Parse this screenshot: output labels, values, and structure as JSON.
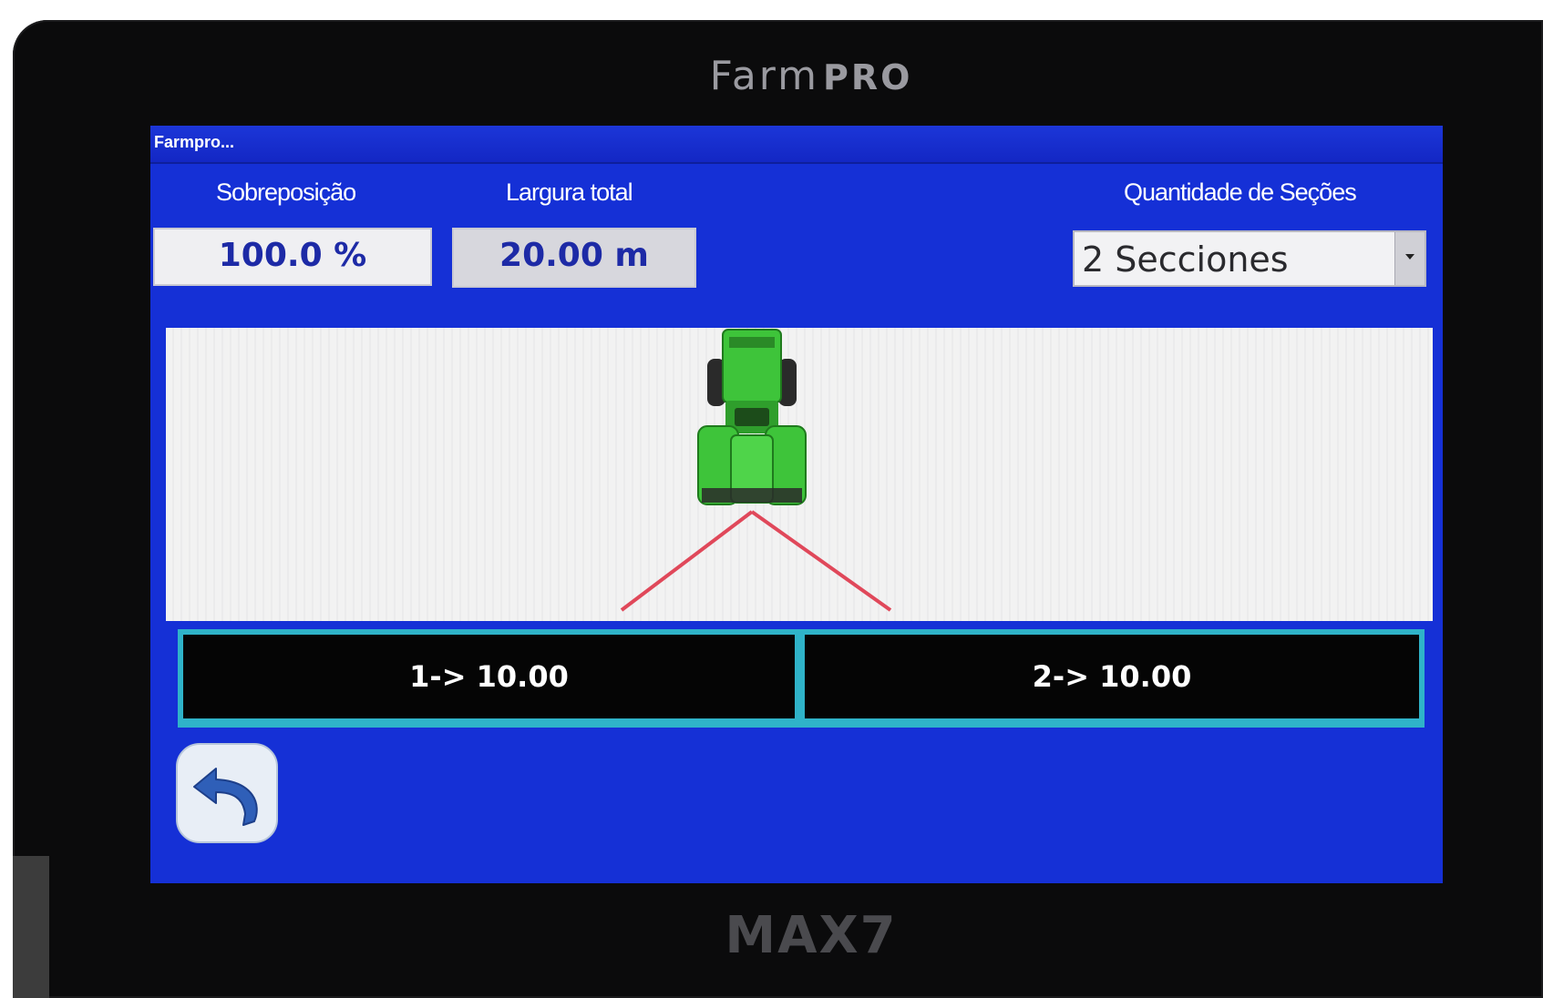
{
  "device": {
    "brand_farm": "Farm",
    "brand_pro": "PRO",
    "model": "MAX7"
  },
  "window": {
    "title": "Farmpro..."
  },
  "overlap": {
    "label": "Sobreposição",
    "value": "100.0 %"
  },
  "total_width": {
    "label": "Largura total",
    "value": "20.00 m"
  },
  "section_count": {
    "label": "Quantidade de Seções",
    "selected": "2 Secciones"
  },
  "sections": [
    {
      "label": "1-> 10.00"
    },
    {
      "label": "2-> 10.00"
    }
  ],
  "icons": {
    "back": "undo-arrow-icon",
    "vehicle": "tractor-icon"
  },
  "colors": {
    "screen_bg": "#1530d6",
    "section_bg": "#050505",
    "section_border": "#2fb3c9",
    "tractor": "#3ec43a",
    "boom_lines": "#e0485a"
  }
}
